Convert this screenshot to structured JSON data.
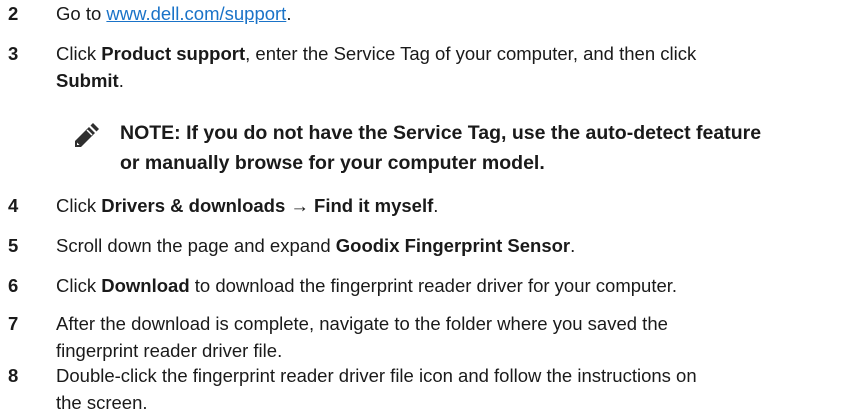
{
  "steps": [
    {
      "num": "2",
      "pre": "Go to ",
      "link": "www.dell.com/support",
      "post": "."
    },
    {
      "num": "3",
      "t1": "Click ",
      "b1": "Product support",
      "t2": ", enter the Service Tag of your computer, and then click",
      "b2": "Submit",
      "t3": "."
    },
    {
      "num": "4",
      "t1": "Click ",
      "b1": "Drivers & downloads",
      "t2": " → ",
      "b2": "Find it myself",
      "t3": "."
    },
    {
      "num": "5",
      "t1": "Scroll down the page and expand ",
      "b1": "Goodix Fingerprint Sensor",
      "t2": "."
    },
    {
      "num": "6",
      "t1": "Click ",
      "b1": "Download",
      "t2": " to download the fingerprint reader driver for your computer."
    },
    {
      "num": "7",
      "line1": "After the download is complete, navigate to the folder where you saved the",
      "line2": "fingerprint reader driver file."
    },
    {
      "num": "8",
      "line1": "Double-click the fingerprint reader driver file icon and follow the instructions on",
      "line2": "the screen."
    }
  ],
  "note": {
    "line1": "NOTE: If you do not have the Service Tag, use the auto-detect feature",
    "line2": "or manually browse for your computer model.",
    "icon": "pencil-note-icon"
  }
}
